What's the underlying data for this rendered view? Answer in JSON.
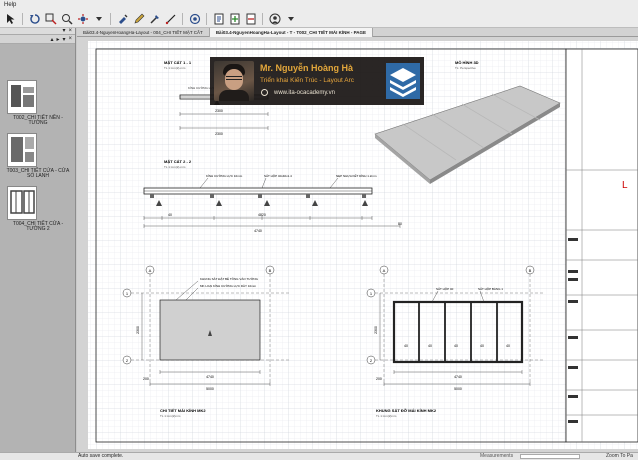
{
  "menu": {
    "help": "Help"
  },
  "toolbar": {
    "icons": [
      "cursor-icon",
      "rotate-icon",
      "zoom-icon",
      "zoom-in-icon",
      "orbit-icon",
      "paint-icon",
      "pencil-icon",
      "dropper-icon",
      "line-icon",
      "scene-icon",
      "page-icon",
      "page-add-icon",
      "page-remove-icon",
      "user-icon"
    ]
  },
  "left_panel": {
    "header_controls": [
      "▾",
      "×"
    ],
    "header2_controls": [
      "▴",
      "▸",
      "▾",
      "×"
    ],
    "pages": [
      {
        "label": "T002_CHI TIẾT NỀN - TƯỜNG"
      },
      {
        "label": "T003_CHI TIẾT CỬA - CỬA SỔ LANH"
      },
      {
        "label": "T004_CHI TIẾT CỬA - TƯỜNG 2"
      }
    ]
  },
  "tabs": [
    {
      "label": "Bài03.4-NguyenHoangHa-Layout - 004_CHI TIẾT MẶT CẮT",
      "active": false
    },
    {
      "label": "Bài03.4-NguyenHoangHa-Layout - T - T002_CHI TIẾT MÁI KÍNH - PAGE",
      "active": true
    }
  ],
  "drawing": {
    "sec1": {
      "title": "MẶT CẮT 1 - 1",
      "scale": "TL 1:mm(2)-mm",
      "dims": [
        "2300",
        "2300"
      ],
      "note": "KÍNH CƯỜNG LỰC"
    },
    "sec2": {
      "title": "MẶT CẮT 2 - 2",
      "scale": "TL 1:mm(2)-mm",
      "notes": [
        "KÍNH CƯỜNG LỰC 10mm",
        "SẮT HỘP 40x40x1.4",
        "NẸP NHỰA KẾT DÍNH 1.2mm"
      ],
      "dims": [
        "40",
        "4820",
        "80",
        "4740"
      ]
    },
    "model": {
      "title": "MÔ HÌNH 3D",
      "scale": "TL: Perspective"
    },
    "plan1": {
      "title": "CHI TIẾT MÁI KÍNH MK2",
      "scale": "TL 1:mm(2)mm",
      "notes": [
        "KHUNG SẮT ĐẶT BÊ TÔNG VÀO TƯỜNG",
        "MK LOẠI KÍNH CƯỜNG LỰC DÀY 10mm"
      ],
      "axes": [
        "A",
        "B",
        "1",
        "2"
      ],
      "dims": [
        "4740",
        "5000",
        "2300",
        "200",
        "200"
      ]
    },
    "plan2": {
      "title": "KHUNG SẮT ĐỠ MÁI KÍNH MK2",
      "scale": "TL 1:mm(2)mm",
      "notes": [
        "SẮT HỘP 40",
        "SẮT HỘP BẢNG 1"
      ],
      "axes": [
        "A",
        "B",
        "1",
        "2"
      ],
      "dims": [
        "40",
        "40",
        "40",
        "40",
        "40",
        "4740",
        "5000",
        "2300",
        "200"
      ]
    },
    "titleblock_glyph": "L"
  },
  "overlay": {
    "name": "Mr. Nguyễn Hoàng Hà",
    "subtitle": "Triển khai Kiến Trúc - Layout Arc",
    "website": "www.ita-ocacademy.vn"
  },
  "status": {
    "left": "Auto save complete.",
    "measure_label": "Measurements",
    "zoom_label": "Zoom To Pa"
  },
  "colors": {
    "overlay_accent": "#e3a73b",
    "logo_blue": "#2f6aa6",
    "canvas": "#d3d3d3"
  }
}
